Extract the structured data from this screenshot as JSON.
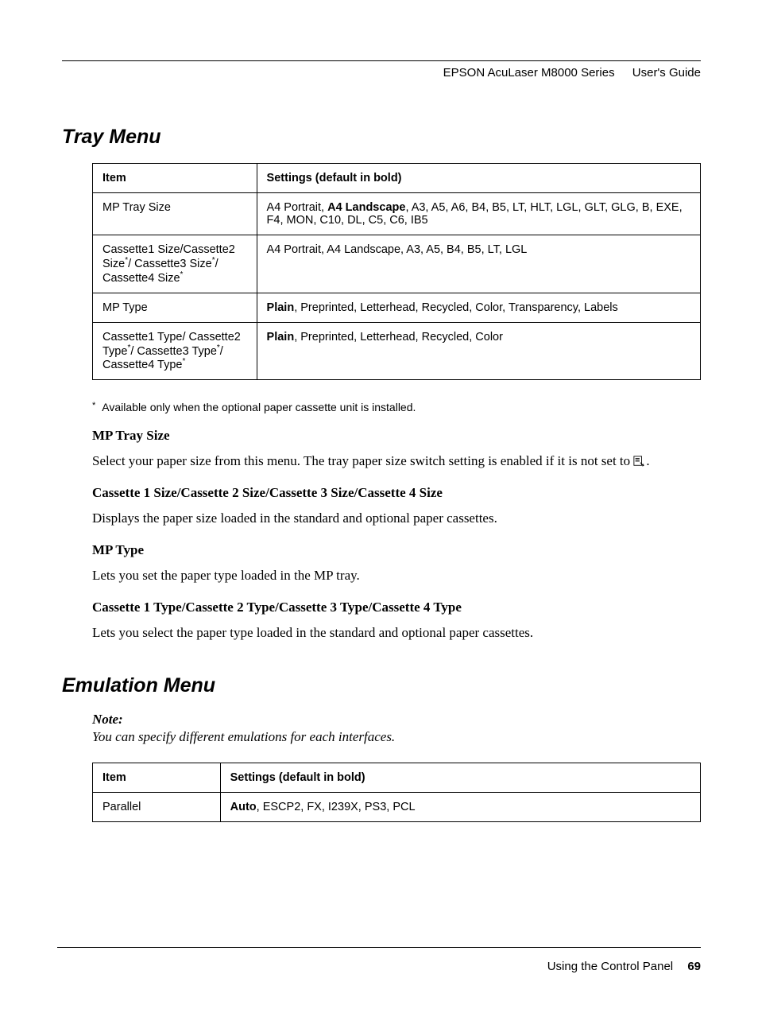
{
  "header": {
    "product": "EPSON AcuLaser M8000 Series",
    "guide": "User's Guide"
  },
  "sections": {
    "tray": {
      "title": "Tray Menu",
      "table": {
        "head": {
          "item": "Item",
          "settings": "Settings (default in bold)"
        },
        "rows": [
          {
            "item_html": "MP Tray Size",
            "settings_prefix": "A4 Portrait, ",
            "settings_bold": "A4 Landscape",
            "settings_suffix": ", A3, A5, A6, B4, B5, LT, HLT, LGL, GLT, GLG, B, EXE, F4, MON, C10, DL, C5, C6, IB5"
          },
          {
            "item_parts": [
              "Cassette1 Size/Cassette2 Size",
              "/ Cassette3 Size",
              "/ Cassette4 Size"
            ],
            "settings_plain": "A4 Portrait, A4 Landscape, A3, A5, B4, B5, LT, LGL"
          },
          {
            "item_html": "MP Type",
            "settings_bold": "Plain",
            "settings_suffix": ", Preprinted, Letterhead, Recycled, Color, Transparency, Labels"
          },
          {
            "item_parts": [
              "Cassette1 Type/ Cassette2 Type",
              "/ Cassette3 Type",
              "/ Cassette4 Type"
            ],
            "settings_bold": "Plain",
            "settings_suffix": ", Preprinted, Letterhead, Recycled, Color"
          }
        ]
      },
      "footnote": "Available only when the optional paper cassette unit is installed.",
      "subs": [
        {
          "head": "MP Tray Size",
          "body_pre": "Select your paper size from this menu. The tray paper size switch setting is enabled if it is not set to ",
          "body_post": "."
        },
        {
          "head": "Cassette 1 Size/Cassette 2 Size/Cassette 3 Size/Cassette 4 Size",
          "body": "Displays the paper size loaded in the standard and optional paper cassettes."
        },
        {
          "head": "MP Type",
          "body": "Lets you set the paper type loaded in the MP tray."
        },
        {
          "head": "Cassette 1 Type/Cassette 2 Type/Cassette 3 Type/Cassette 4 Type",
          "body": "Lets you select the paper type loaded in the standard and optional paper cassettes."
        }
      ]
    },
    "emulation": {
      "title": "Emulation Menu",
      "note_label": "Note:",
      "note_body": "You can specify different emulations for each interfaces.",
      "table": {
        "head": {
          "item": "Item",
          "settings": "Settings (default in bold)"
        },
        "rows": [
          {
            "item_html": "Parallel",
            "settings_bold": "Auto",
            "settings_suffix": ", ESCP2, FX, I239X, PS3, PCL"
          }
        ]
      }
    }
  },
  "footer": {
    "section": "Using the Control Panel",
    "page": "69"
  }
}
